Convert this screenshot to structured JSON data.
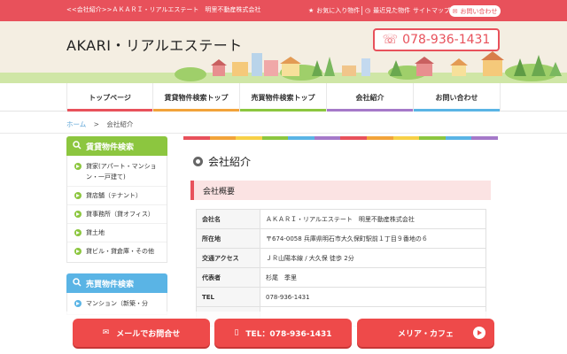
{
  "topbar": {
    "tagline": "<<会社紹介>>ＡＫＡＲＩ・リアルエステート　明里不動産株式会社",
    "favorites_label": "お気に入り物件",
    "recent_label": "最近見た物件",
    "sitemap_label": "サイトマップ",
    "contact_label": "お問い合わせ"
  },
  "header": {
    "logo": "AKARI・リアルエステート",
    "phone": "078-936-1431"
  },
  "nav": {
    "items": [
      {
        "label": "トップページ",
        "color": "#e8515b"
      },
      {
        "label": "賃貸物件検索トップ",
        "color": "#f2a33a"
      },
      {
        "label": "売買物件検索トップ",
        "color": "#8cc63f"
      },
      {
        "label": "会社紹介",
        "color": "#a579c9"
      },
      {
        "label": "お問い合わせ",
        "color": "#5ab4e5"
      }
    ]
  },
  "breadcrumb": {
    "home": "ホーム",
    "separator": ">",
    "current": "会社紹介"
  },
  "sidebar": {
    "rental": {
      "title": "賃貸物件検索",
      "color": "#8cc63f",
      "items": [
        "貸家(アパート・マンション・一戸建て)",
        "貸店舗（テナント）",
        "貸事務所（貸オフィス）",
        "貸土地",
        "貸ビル・貸倉庫・その他"
      ]
    },
    "sale": {
      "title": "売買物件検索",
      "color": "#5ab4e5",
      "items": [
        "マンション（新築・分"
      ]
    }
  },
  "main": {
    "page_title": "会社紹介",
    "section_title": "会社概要",
    "rows": [
      {
        "key": "会社名",
        "value": "ＡＫＡＲＩ・リアルエステート　明里不動産株式会社"
      },
      {
        "key": "所在地",
        "value": "〒674-0058 兵庫県明石市大久保町駅前１丁目９番地の６"
      },
      {
        "key": "交通アクセス",
        "value": "ＪＲ山陽本線 / 大久保 徒歩 2分"
      },
      {
        "key": "代表者",
        "value": "杉尾　季里"
      },
      {
        "key": "TEL",
        "value": "078-936-1431"
      },
      {
        "key": "",
        "value": ""
      }
    ]
  },
  "cta": {
    "mail_label": "メールでお問合せ",
    "tel_label": "TEL：078-936-1431",
    "cafe_label": "メリア・カフェ"
  },
  "colors": {
    "brand_red": "#e8515b",
    "cta_red": "#ee4a4a",
    "header_bg": "#f4eee2"
  }
}
